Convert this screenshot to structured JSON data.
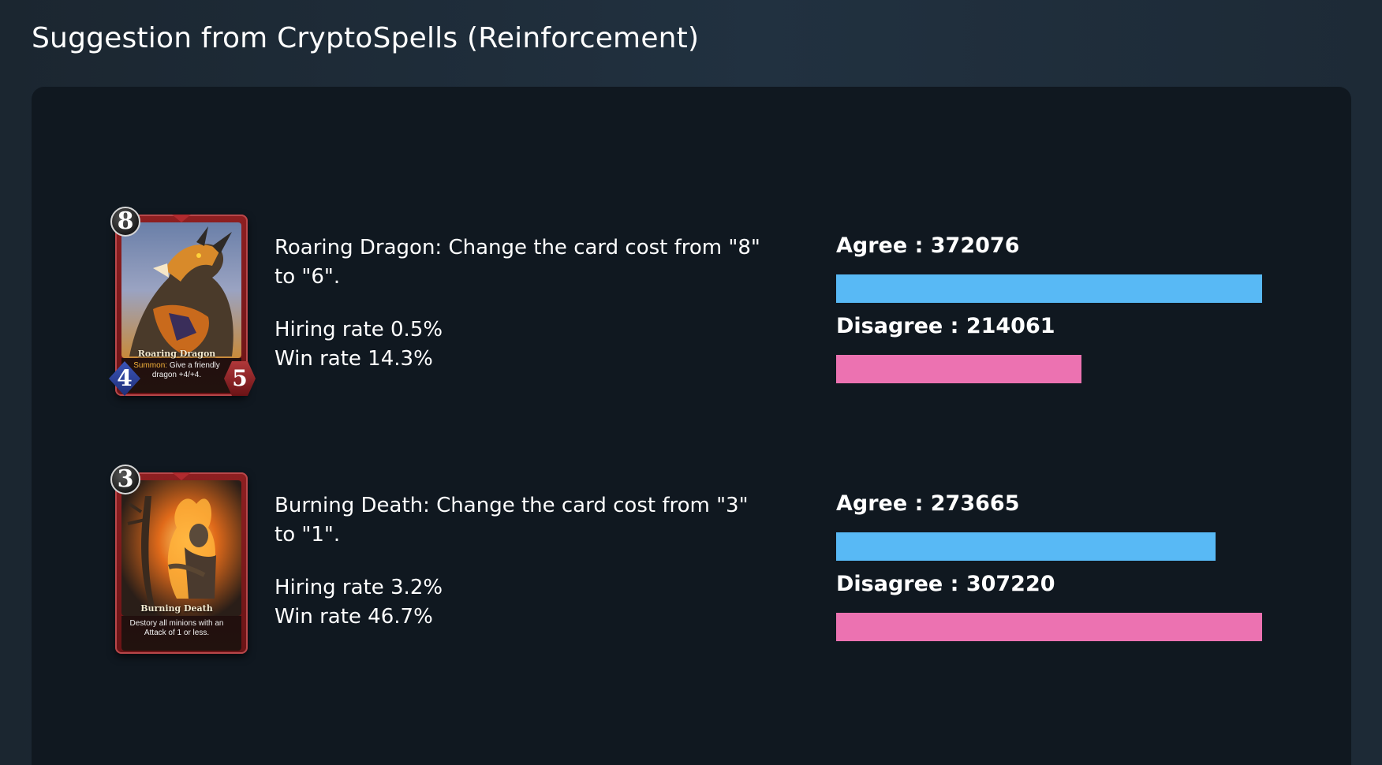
{
  "page": {
    "title": "Suggestion from CryptoSpells (Reinforcement)"
  },
  "colors": {
    "agree_bar": "#58b9f5",
    "disagree_bar": "#ec72b1",
    "panel_bg": "#101820"
  },
  "suggestions": [
    {
      "card": {
        "cost": "8",
        "name": "Roaring Dragon",
        "text_keyword": "Summon:",
        "text": " Give a friendly dragon +4/+4.",
        "attack": "4",
        "health": "5",
        "art": "dragon-illustration"
      },
      "description": "Roaring Dragon: Change the card cost from \"8\" to \"6\".",
      "hiring_rate": "Hiring rate 0.5%",
      "win_rate": "Win rate 14.3%",
      "agree_label": "Agree : 372076",
      "disagree_label": "Disagree : 214061",
      "agree_votes": 372076,
      "disagree_votes": 214061
    },
    {
      "card": {
        "cost": "3",
        "name": "Burning Death",
        "text_keyword": "",
        "text": "Destory all minions with an Attack of 1 or less.",
        "art": "fire-skeleton-illustration"
      },
      "description": "Burning Death: Change the card cost from \"3\" to \"1\".",
      "hiring_rate": "Hiring rate 3.2%",
      "win_rate": "Win rate 46.7%",
      "agree_label": "Agree : 273665",
      "disagree_label": "Disagree : 307220",
      "agree_votes": 273665,
      "disagree_votes": 307220
    }
  ]
}
